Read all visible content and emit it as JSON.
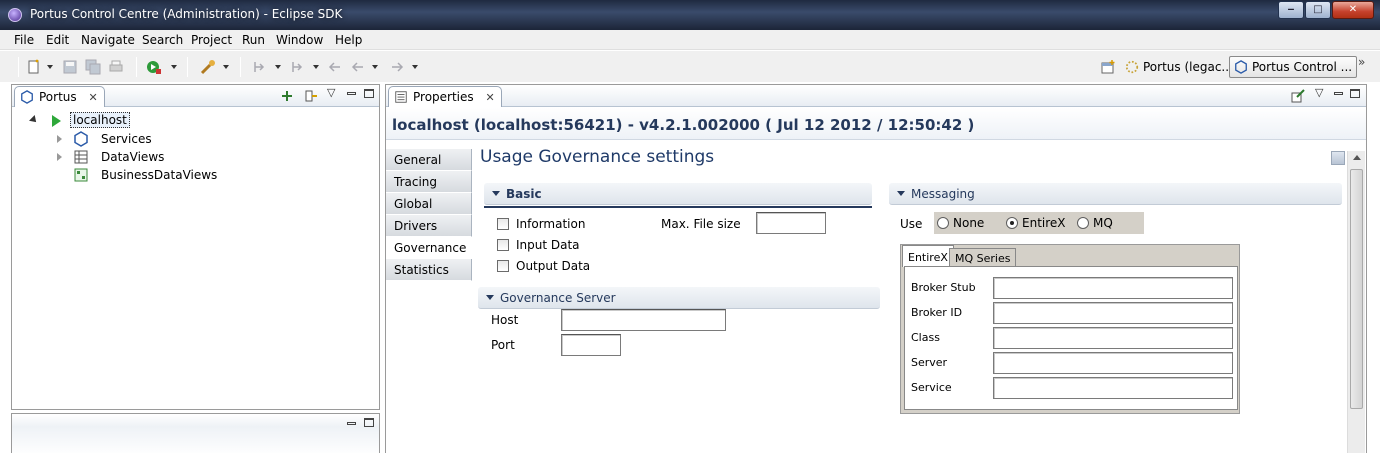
{
  "window": {
    "title": "Portus Control Centre (Administration) - Eclipse SDK",
    "buttons": {
      "minimize": "‒",
      "maximize": "□",
      "close": "✕"
    }
  },
  "menu": [
    {
      "label": "File"
    },
    {
      "label": "Edit"
    },
    {
      "label": "Navigate"
    },
    {
      "label": "Search"
    },
    {
      "label": "Project"
    },
    {
      "label": "Run"
    },
    {
      "label": "Window"
    },
    {
      "label": "Help"
    }
  ],
  "toolbar": {
    "overflow": "»",
    "perspectives": [
      {
        "label": "Portus (legac...",
        "active": false
      },
      {
        "label": "Portus Control ...",
        "active": true
      }
    ]
  },
  "left_view": {
    "tab_label": "Portus",
    "tree": [
      {
        "label": "localhost",
        "level": 0,
        "expanded": true,
        "selected": true,
        "icon": "run-icon"
      },
      {
        "label": "Services",
        "level": 1,
        "expanded": false,
        "icon": "services-icon"
      },
      {
        "label": "DataViews",
        "level": 1,
        "expanded": false,
        "icon": "table-icon"
      },
      {
        "label": "BusinessDataViews",
        "level": 1,
        "leaf": true,
        "icon": "business-icon"
      }
    ]
  },
  "properties": {
    "tab_label": "Properties",
    "header": "localhost (localhost:56421) - v4.2.1.002000 ( Jul 12 2012 / 12:50:42 )",
    "side_tabs": [
      {
        "label": "General",
        "active": false
      },
      {
        "label": "Tracing",
        "active": false
      },
      {
        "label": "Global",
        "active": false
      },
      {
        "label": "Drivers",
        "active": false
      },
      {
        "label": "Governance",
        "active": true
      },
      {
        "label": "Statistics",
        "active": false
      }
    ],
    "content_title": "Usage Governance settings",
    "basic": {
      "title": "Basic",
      "checkboxes": [
        {
          "label": "Information",
          "checked": false
        },
        {
          "label": "Input Data",
          "checked": false
        },
        {
          "label": "Output Data",
          "checked": false
        }
      ],
      "max_file_size_label": "Max. File size",
      "max_file_size_value": ""
    },
    "governance_server": {
      "title": "Governance Server",
      "host_label": "Host",
      "host_value": "",
      "port_label": "Port",
      "port_value": ""
    },
    "messaging": {
      "title": "Messaging",
      "use_label": "Use",
      "options": [
        {
          "label": "None",
          "selected": false
        },
        {
          "label": "EntireX",
          "selected": true
        },
        {
          "label": "MQ",
          "selected": false
        }
      ],
      "tabs": [
        {
          "label": "EntireX",
          "active": true
        },
        {
          "label": "MQ Series",
          "active": false
        }
      ],
      "fields": [
        {
          "label": "Broker Stub",
          "value": ""
        },
        {
          "label": "Broker ID",
          "value": ""
        },
        {
          "label": "Class",
          "value": ""
        },
        {
          "label": "Server",
          "value": ""
        },
        {
          "label": "Service",
          "value": ""
        }
      ]
    }
  }
}
